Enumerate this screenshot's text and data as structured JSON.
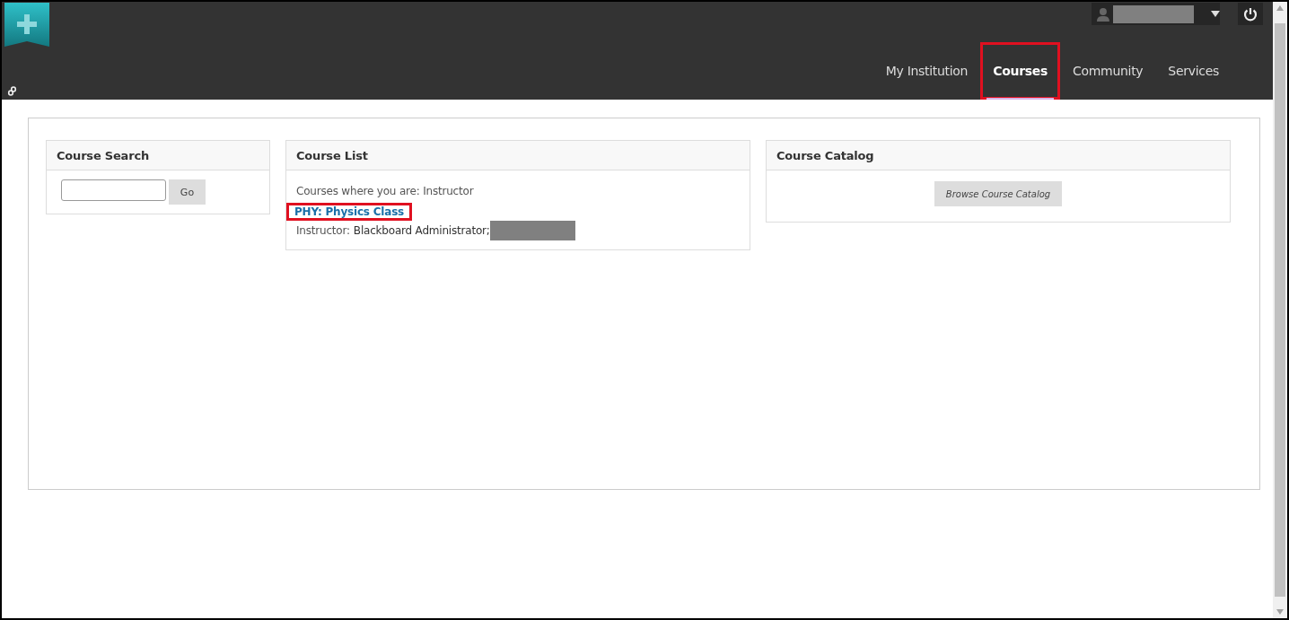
{
  "header": {
    "tabs": [
      {
        "label": "My Institution",
        "selected": false,
        "highlighted": false
      },
      {
        "label": "Courses",
        "selected": true,
        "highlighted": true
      },
      {
        "label": "Community",
        "selected": false,
        "highlighted": false
      },
      {
        "label": "Services",
        "selected": false,
        "highlighted": false
      }
    ]
  },
  "modules": [
    {
      "kind": "search",
      "title": "Course Search",
      "button": "Go"
    },
    {
      "kind": "list",
      "title": "Course List",
      "intro": "Courses where you are: Instructor",
      "courses": [
        {
          "title": "PHY: Physics Class",
          "highlighted": true,
          "instructor_label": "Instructor:",
          "instructor_name": "Blackboard Administrator;"
        }
      ]
    },
    {
      "kind": "catalog",
      "title": "Course Catalog",
      "button": "Browse Course Catalog"
    }
  ]
}
